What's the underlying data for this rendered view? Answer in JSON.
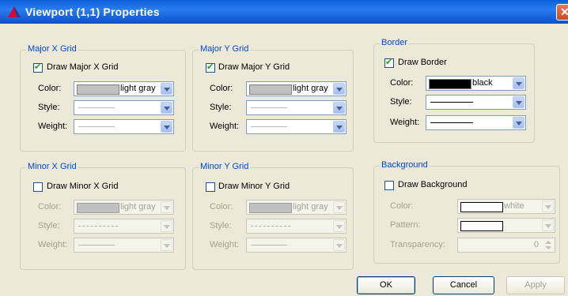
{
  "window": {
    "title": "Viewport (1,1) Properties",
    "close_label": "✕"
  },
  "colors": {
    "titlebar": "#0a5fd8",
    "group_label": "#0046d5",
    "disabled_text": "#a3a192"
  },
  "groups": {
    "major_x": {
      "title": "Major X Grid",
      "checkbox_label": "Draw Major X Grid",
      "checked": true,
      "color_label": "Color:",
      "color_value": "light gray",
      "style_label": "Style:",
      "weight_label": "Weight:"
    },
    "major_y": {
      "title": "Major Y Grid",
      "checkbox_label": "Draw Major Y Grid",
      "checked": true,
      "color_label": "Color:",
      "color_value": "light gray",
      "style_label": "Style:",
      "weight_label": "Weight:"
    },
    "border": {
      "title": "Border",
      "checkbox_label": "Draw Border",
      "checked": true,
      "color_label": "Color:",
      "color_value": "black",
      "style_label": "Style:",
      "weight_label": "Weight:"
    },
    "minor_x": {
      "title": "Minor X Grid",
      "checkbox_label": "Draw Minor X Grid",
      "checked": false,
      "color_label": "Color:",
      "color_value": "light gray",
      "style_label": "Style:",
      "weight_label": "Weight:"
    },
    "minor_y": {
      "title": "Minor Y Grid",
      "checkbox_label": "Draw Minor Y Grid",
      "checked": false,
      "color_label": "Color:",
      "color_value": "light gray",
      "style_label": "Style:",
      "weight_label": "Weight:"
    },
    "background": {
      "title": "Background",
      "checkbox_label": "Draw Background",
      "checked": false,
      "color_label": "Color:",
      "color_value": "white",
      "pattern_label": "Pattern:",
      "transparency_label": "Transparency:",
      "transparency_value": "0"
    }
  },
  "buttons": {
    "ok": "OK",
    "cancel": "Cancel",
    "apply": "Apply"
  }
}
